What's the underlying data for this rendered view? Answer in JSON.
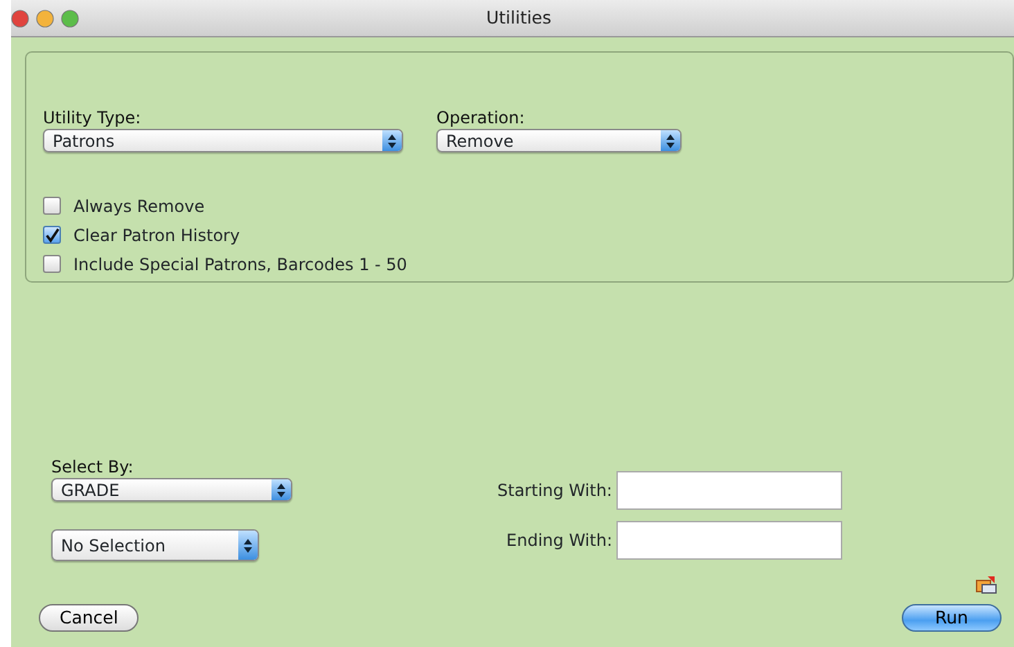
{
  "window": {
    "title": "Utilities"
  },
  "utility_type": {
    "label": "Utility Type:",
    "value": "Patrons"
  },
  "operation": {
    "label": "Operation:",
    "value": "Remove"
  },
  "options": [
    {
      "label": "Always Remove",
      "checked": false
    },
    {
      "label": "Clear Patron History",
      "checked": true
    },
    {
      "label": "Include Special Patrons, Barcodes 1 - 50",
      "checked": false
    }
  ],
  "select_by": {
    "label": "Select By:",
    "value": "GRADE"
  },
  "selection": {
    "value": "No Selection"
  },
  "starting_with": {
    "label": "Starting With:"
  },
  "ending_with": {
    "label": "Ending With:"
  },
  "buttons": [
    {
      "label": "Cancel",
      "kind": "normal"
    },
    {
      "label": "Run",
      "kind": "default"
    }
  ]
}
